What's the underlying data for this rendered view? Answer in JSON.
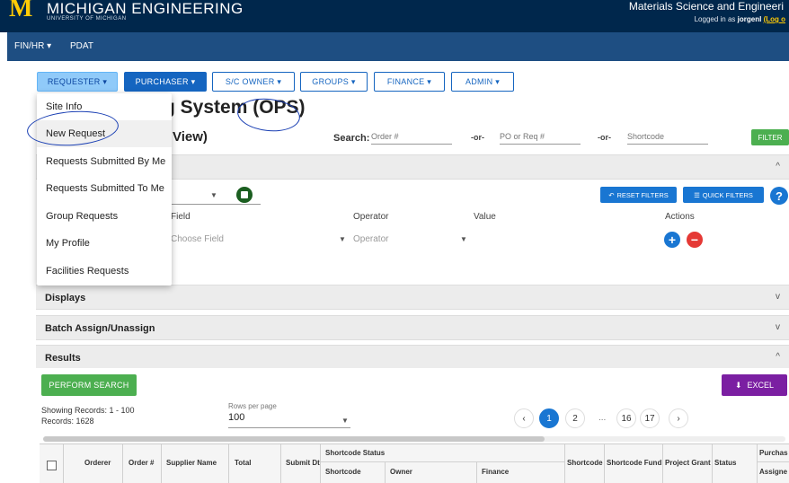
{
  "header": {
    "logo": "M",
    "brand": "MICHIGAN ENGINEERING",
    "brand_sub": "UNIVERSITY OF MICHIGAN",
    "department": "Materials Science and Engineeri",
    "logged_prefix": "Logged in as ",
    "user": "jorgenl",
    "logout": "(Log o"
  },
  "nav": {
    "finhr": "FIN/HR ▾",
    "pdat": "PDAT"
  },
  "menus": [
    "REQUESTER ▾",
    "PURCHASER ▾",
    "S/C OWNER ▾",
    "GROUPS ▾",
    "FINANCE ▾",
    "ADMIN ▾"
  ],
  "dropdown": [
    "Site Info",
    "New Request",
    "Requests Submitted By Me",
    "Requests Submitted To Me",
    "Group Requests",
    "My Profile",
    "Facilities Requests"
  ],
  "page": {
    "title": "g System (OPS)",
    "subtitle": "r View)"
  },
  "search": {
    "label": "Search:",
    "order_placeholder": "Order #",
    "po_placeholder": "PO or Req #",
    "shortcode_placeholder": "Shortcode",
    "or": "-or-",
    "filter_button": "FILTER"
  },
  "filters": {
    "reset": "RESET FILTERS",
    "quick": "QUICK FILTERS",
    "help": "?",
    "col_field": "Field",
    "col_operator": "Operator",
    "col_value": "Value",
    "col_actions": "Actions",
    "field_placeholder": "Choose Field",
    "operator_placeholder": "Operator",
    "add": "+",
    "remove": "−"
  },
  "panels": {
    "displays": "Displays",
    "batch": "Batch Assign/Unassign",
    "results": "Results"
  },
  "results": {
    "perform": "PERFORM SEARCH",
    "excel": "EXCEL",
    "showing": "Showing Records: 1 - 100",
    "records": "Records: 1628",
    "rows_label": "Rows per page",
    "rows_value": "100",
    "pages": [
      "1",
      "2",
      "...",
      "16",
      "17"
    ],
    "prev": "‹",
    "next": "›"
  },
  "table": {
    "orderer": "Orderer",
    "order_num": "Order #",
    "supplier": "Supplier Name",
    "total": "Total",
    "submit_dt": "Submit Dt",
    "sc_status": "Shortcode Status",
    "shortcode": "Shortcode",
    "owner": "Owner",
    "finance": "Finance",
    "shortcode2": "Shortcode",
    "sc_fund": "Shortcode Fund",
    "project_grant": "Project Grant",
    "status": "Status",
    "purchase": "Purchas",
    "assignee": "Assigne"
  }
}
